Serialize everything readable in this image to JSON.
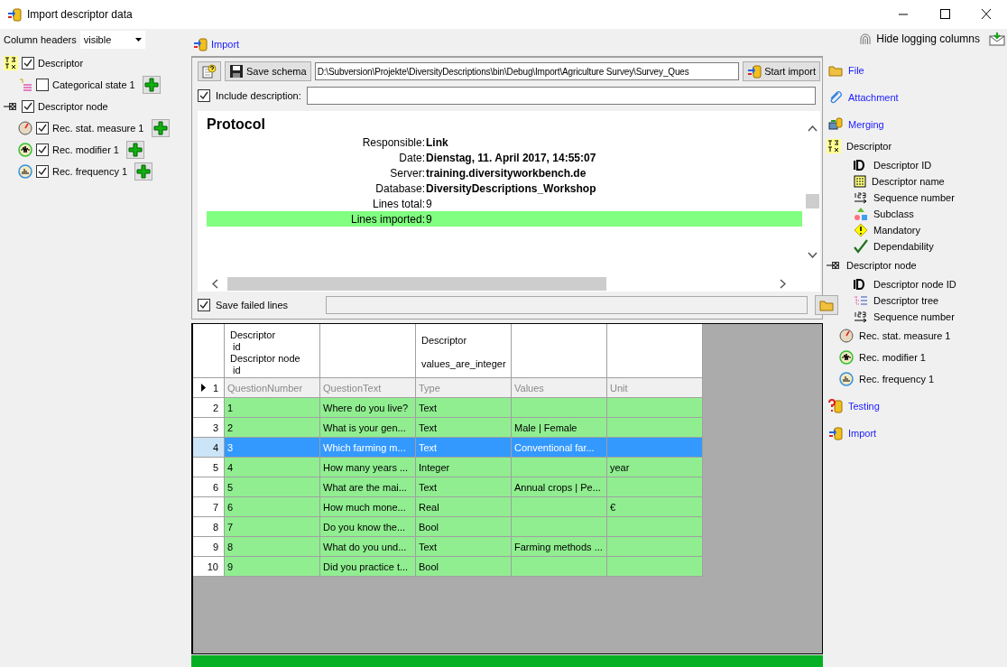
{
  "window": {
    "title": "Import descriptor data"
  },
  "column_headers": {
    "label": "Column headers",
    "value": "visible"
  },
  "left_tree": [
    {
      "label": "Descriptor",
      "checked": true,
      "children": [
        {
          "label": "Categorical state 1",
          "checked": false,
          "add": true
        }
      ]
    },
    {
      "label": "Descriptor node",
      "checked": true,
      "children": [
        {
          "label": "Rec. stat. measure 1",
          "checked": true,
          "add": true
        },
        {
          "label": "Rec. modifier 1",
          "checked": true,
          "add": true
        },
        {
          "label": "Rec. frequency 1",
          "checked": true,
          "add": true
        }
      ]
    }
  ],
  "import_link": "Import",
  "toolbar": {
    "save_schema": "Save schema",
    "schema_path": "D:\\Subversion\\Projekte\\DiversityDescriptions\\bin\\Debug\\Import\\Agriculture Survey\\Survey_Ques",
    "start_import": "Start import"
  },
  "include_description": {
    "label": "Include description:",
    "checked": true
  },
  "protocol": {
    "title": "Protocol",
    "rows": [
      {
        "label": "Responsible:",
        "value": "Link",
        "bold": true,
        "highlighted": false
      },
      {
        "label": "Date:",
        "value": "Dienstag, 11. April 2017, 14:55:07",
        "bold": true,
        "highlighted": false
      },
      {
        "label": "Server:",
        "value": "training.diversityworkbench.de",
        "bold": true,
        "highlighted": false
      },
      {
        "label": "Database:",
        "value": "DiversityDescriptions_Workshop",
        "bold": true,
        "highlighted": false
      },
      {
        "label": "Lines total:",
        "value": "9",
        "bold": false,
        "highlighted": false
      },
      {
        "label": "Lines imported:",
        "value": "9",
        "bold": false,
        "highlighted": true
      }
    ]
  },
  "save_failed": {
    "label": "Save failed lines",
    "checked": true
  },
  "grid": {
    "header_cells": [
      {
        "text": "Descriptor\n id\nDescriptor node\n id"
      },
      {},
      {
        "text": "Descriptor\n\nvalues_are_integer"
      },
      {},
      {}
    ],
    "rows": [
      {
        "number": "1",
        "kind": "header",
        "current": true,
        "selected": false,
        "cells": [
          "QuestionNumber",
          "QuestionText",
          "Type",
          "Values",
          "Unit"
        ]
      },
      {
        "number": "2",
        "kind": "data",
        "current": false,
        "selected": false,
        "cells": [
          "1",
          "Where do you live?",
          "Text",
          null,
          null
        ]
      },
      {
        "number": "3",
        "kind": "data",
        "current": false,
        "selected": false,
        "cells": [
          "2",
          "What is your gen...",
          "Text",
          "Male | Female",
          null
        ]
      },
      {
        "number": "4",
        "kind": "data",
        "current": false,
        "selected": true,
        "cells": [
          "3",
          "Which farming m...",
          "Text",
          "Conventional far...",
          null
        ]
      },
      {
        "number": "5",
        "kind": "data",
        "current": false,
        "selected": false,
        "cells": [
          "4",
          "How many years ...",
          "Integer",
          null,
          "year"
        ]
      },
      {
        "number": "6",
        "kind": "data",
        "current": false,
        "selected": false,
        "cells": [
          "5",
          "What are the mai...",
          "Text",
          "Annual crops | Pe...",
          null
        ]
      },
      {
        "number": "7",
        "kind": "data",
        "current": false,
        "selected": false,
        "cells": [
          "6",
          "How much mone...",
          "Real",
          null,
          "€"
        ]
      },
      {
        "number": "8",
        "kind": "data",
        "current": false,
        "selected": false,
        "cells": [
          "7",
          "Do you know the...",
          "Bool",
          null,
          null
        ]
      },
      {
        "number": "9",
        "kind": "data",
        "current": false,
        "selected": false,
        "cells": [
          "8",
          "What do you und...",
          "Text",
          "Farming methods ...",
          null
        ]
      },
      {
        "number": "10",
        "kind": "data",
        "current": false,
        "selected": false,
        "cells": [
          "9",
          "Did you practice t...",
          "Bool",
          null,
          null
        ]
      }
    ]
  },
  "progress": {
    "level": 1
  },
  "hide_logging": "Hide logging columns",
  "right_panel": [
    {
      "label": "File",
      "kind": "link"
    },
    {
      "label": "Attachment",
      "kind": "link"
    },
    {
      "label": "Merging",
      "kind": "link"
    },
    {
      "label": "Descriptor",
      "kind": "group",
      "children": [
        {
          "label": "Descriptor ID"
        },
        {
          "label": "Descriptor name"
        },
        {
          "label": "Sequence number"
        },
        {
          "label": "Subclass"
        },
        {
          "label": "Mandatory"
        },
        {
          "label": "Dependability"
        }
      ]
    },
    {
      "label": "Descriptor node",
      "kind": "group",
      "children": [
        {
          "label": "Descriptor node ID"
        },
        {
          "label": "Descriptor tree"
        },
        {
          "label": "Sequence number"
        }
      ]
    },
    {
      "label": "Rec. stat. measure 1",
      "kind": "sub"
    },
    {
      "label": "Rec. modifier 1",
      "kind": "sub"
    },
    {
      "label": "Rec. frequency 1",
      "kind": "sub"
    },
    {
      "label": "Testing",
      "kind": "link"
    },
    {
      "label": "Import",
      "kind": "link"
    }
  ]
}
